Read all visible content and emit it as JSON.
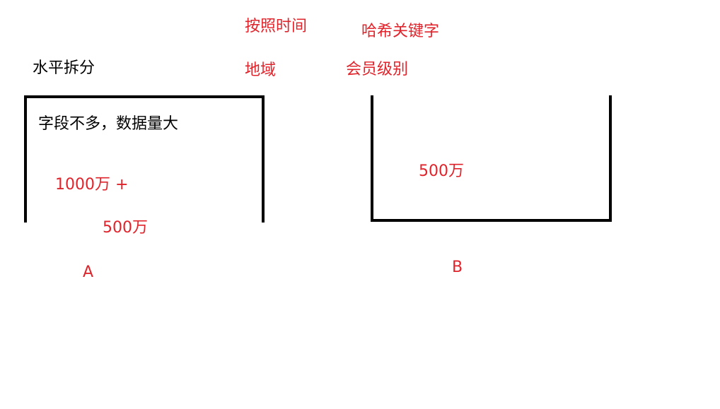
{
  "title": "水平拆分",
  "strategies": {
    "by_time": "按照时间",
    "hash_key": "哈希关键字",
    "region": "地域",
    "member_level": "会员级别"
  },
  "box_a": {
    "label": "A",
    "description": "字段不多，数据量大",
    "amount_main": "1000万 +",
    "amount_extra": "500万"
  },
  "box_b": {
    "label": "B",
    "amount": "500万"
  },
  "colors": {
    "annotation": "#e0242b",
    "text": "#000000",
    "border": "#000000"
  }
}
